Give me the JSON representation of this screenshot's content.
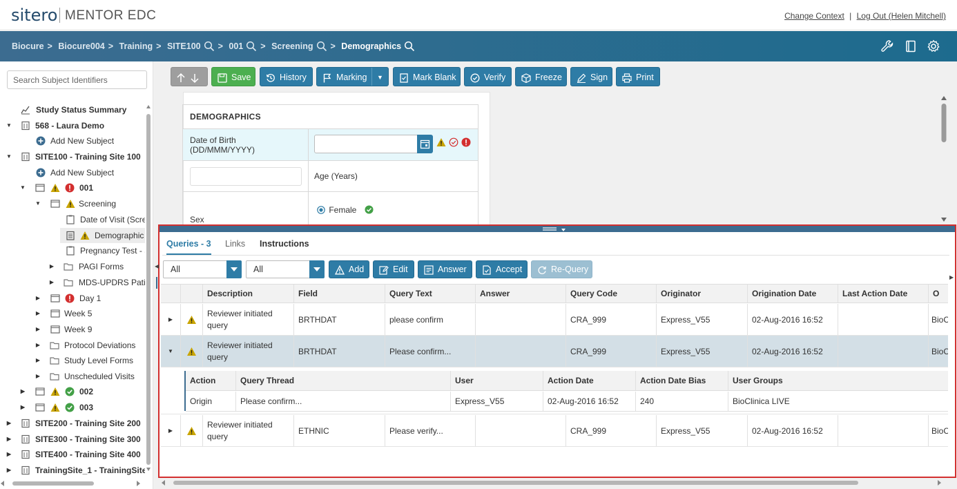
{
  "header": {
    "logo_brand": "sitero",
    "logo_product": "MENTOR EDC",
    "change_context": "Change Context",
    "divider": "|",
    "logout": "Log Out (Helen Mitchell)"
  },
  "breadcrumb": {
    "items": [
      "Biocure",
      "Biocure004",
      "Training",
      "SITE100",
      "001",
      "Screening"
    ],
    "current": "Demographics",
    "separator": ">"
  },
  "sidebar": {
    "search_placeholder": "Search Subject Identifiers",
    "tree": {
      "study_status": "Study Status Summary",
      "site568": "568 - Laura Demo",
      "add_subject_1": "Add New Subject",
      "site100": "SITE100 - Training Site 100",
      "add_subject_2": "Add New Subject",
      "subj001": "001",
      "screening": "Screening",
      "date_of_visit": "Date of Visit (Scre",
      "demographics": "Demographic",
      "pregnancy": "Pregnancy Test - S",
      "pagi": "PAGI Forms",
      "mds": "MDS-UPDRS Patie",
      "day1": "Day 1",
      "week5": "Week 5",
      "week9": "Week 9",
      "protocol": "Protocol Deviations",
      "study_level": "Study Level Forms",
      "unscheduled": "Unscheduled Visits",
      "subj002": "002",
      "subj003": "003",
      "site200": "SITE200 - Training Site 200",
      "site300": "SITE300 - Training Site 300",
      "site400": "SITE400 - Training Site 400",
      "trainingsite1": "TrainingSite_1 - TrainingSite"
    }
  },
  "toolbar": {
    "save": "Save",
    "history": "History",
    "marking": "Marking",
    "mark_blank": "Mark Blank",
    "verify": "Verify",
    "freeze": "Freeze",
    "sign": "Sign",
    "print": "Print"
  },
  "form": {
    "title": "DEMOGRAPHICS",
    "dob_label": "Date of Birth (DD/MMM/YYYY)",
    "dob_value": "",
    "age_label": "Age (Years)",
    "age_value": "",
    "sex_label": "Sex",
    "sex_option": "Female"
  },
  "queries": {
    "tabs": {
      "queries": "Queries - 3",
      "links": "Links",
      "instructions": "Instructions"
    },
    "filter1": "All",
    "filter2": "All",
    "buttons": {
      "add": "Add",
      "edit": "Edit",
      "answer": "Answer",
      "accept": "Accept",
      "requery": "Re-Query"
    },
    "columns": [
      "Description",
      "Field",
      "Query Text",
      "Answer",
      "Query Code",
      "Originator",
      "Origination Date",
      "Last Action Date",
      "O"
    ],
    "rows": [
      {
        "description": "Reviewer initiated query",
        "field": "BRTHDAT",
        "query_text": "please confirm",
        "answer": "",
        "query_code": "CRA_999",
        "originator": "Express_V55",
        "origination_date": "02-Aug-2016 16:52",
        "last_action_date": "",
        "o": "BioC"
      },
      {
        "description": "Reviewer initiated query",
        "field": "BRTHDAT",
        "query_text": "Please confirm...",
        "answer": "",
        "query_code": "CRA_999",
        "originator": "Express_V55",
        "origination_date": "02-Aug-2016 16:52",
        "last_action_date": "",
        "o": "BioC"
      },
      {
        "description": "Reviewer initiated query",
        "field": "ETHNIC",
        "query_text": "Please verify...",
        "answer": "",
        "query_code": "CRA_999",
        "originator": "Express_V55",
        "origination_date": "02-Aug-2016 16:52",
        "last_action_date": "",
        "o": "BioC"
      }
    ],
    "thread": {
      "columns": [
        "Action",
        "Query Thread",
        "User",
        "Action Date",
        "Action Date Bias",
        "User Groups"
      ],
      "row": {
        "action": "Origin",
        "thread": "Please confirm...",
        "user": "Express_V55",
        "action_date": "02-Aug-2016 16:52",
        "bias": "240",
        "groups": "BioClinica LIVE"
      }
    }
  },
  "colors": {
    "accent": "#2e7ca6",
    "save": "#4caf50",
    "warning": "#c9a400",
    "error": "#d32f2f",
    "ok": "#43a047",
    "highlight_border": "#d32f2f"
  }
}
